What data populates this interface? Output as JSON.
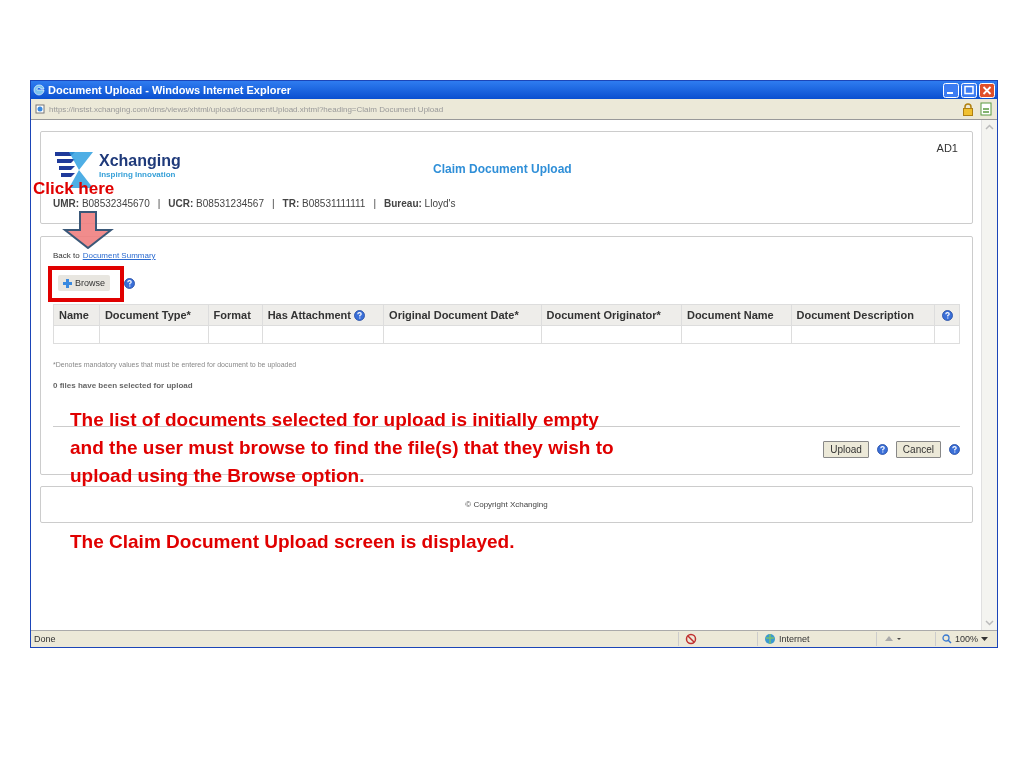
{
  "window": {
    "title": "Document Upload - Windows Internet Explorer",
    "address": "https://instst.xchanging.com/dms/views/xhtml/upload/documentUpload.xhtml?heading=Claim Document Upload"
  },
  "header": {
    "logo_name": "Xchanging",
    "logo_tagline": "Inspiring Innovation",
    "page_title": "Claim Document Upload",
    "user_code": "AD1",
    "references": [
      {
        "kind": "field",
        "label": "UMR:",
        "value": "B08532345670"
      },
      {
        "kind": "separator",
        "text": "|"
      },
      {
        "kind": "field",
        "label": "UCR:",
        "value": "B08531234567"
      },
      {
        "kind": "separator",
        "text": "|"
      },
      {
        "kind": "field",
        "label": "TR:",
        "value": "B08531111111"
      },
      {
        "kind": "separator",
        "text": "|"
      },
      {
        "kind": "field",
        "label": "Bureau:",
        "value": "Lloyd's"
      }
    ]
  },
  "back_link": {
    "prefix": "Back to",
    "link": "Document Summary"
  },
  "browse_button": "Browse",
  "table": {
    "columns": [
      {
        "kind": "text",
        "label": "Name",
        "help": false
      },
      {
        "kind": "text",
        "label": "Document Type*",
        "help": false
      },
      {
        "kind": "text",
        "label": "Format",
        "help": false
      },
      {
        "kind": "text",
        "label": "Has Attachment",
        "help": true
      },
      {
        "kind": "text",
        "label": "Original Document Date*",
        "help": false
      },
      {
        "kind": "text",
        "label": "Document Originator*",
        "help": false
      },
      {
        "kind": "text",
        "label": "Document Name",
        "help": false
      },
      {
        "kind": "text",
        "label": "Document Description",
        "help": false
      },
      {
        "kind": "help"
      }
    ]
  },
  "note": "*Denotes mandatory values that must be entered for document to be uploaded",
  "file_count": "0 files have been selected for upload",
  "buttons": [
    "Upload",
    "Cancel"
  ],
  "footer": "© Copyright Xchanging",
  "status_bar": {
    "text": "Done",
    "zone": "Internet",
    "zoom": "100%"
  },
  "annotations": [
    {
      "kind": "callout",
      "text": "Click here"
    },
    {
      "kind": "caption",
      "text": "The list of documents selected for upload is initially empty and the user must browse to find the file(s) that they wish to upload using the Browse option."
    },
    {
      "kind": "overlay",
      "text": "The Claim Document Upload screen is displayed."
    }
  ]
}
